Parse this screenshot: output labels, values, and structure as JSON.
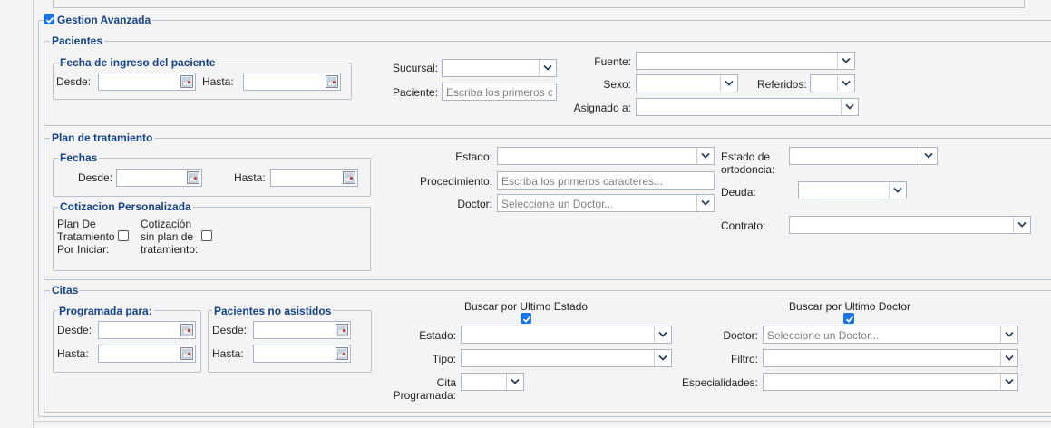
{
  "advanced": {
    "label": "Gestion Avanzada",
    "checked": true
  },
  "pacientes": {
    "legend": "Pacientes",
    "fecha_ingreso": {
      "legend": "Fecha de ingreso del paciente",
      "desde": "Desde:",
      "hasta": "Hasta:"
    },
    "sucursal": "Sucursal:",
    "paciente": {
      "label": "Paciente:",
      "placeholder": "Escriba los primeros ca"
    },
    "fuente": "Fuente:",
    "sexo": "Sexo:",
    "referidos": "Referidos:",
    "asignado": "Asignado a:"
  },
  "plan": {
    "legend": "Plan de tratamiento",
    "fechas": {
      "legend": "Fechas",
      "desde": "Desde:",
      "hasta": "Hasta:"
    },
    "cotizacion": {
      "legend": "Cotizacion Personalizada",
      "plan_iniciar": [
        "Plan De",
        "Tratamiento",
        "Por Iniciar:"
      ],
      "sin_plan": [
        "Cotización",
        "sin plan de",
        "tratamiento:"
      ]
    },
    "estado": "Estado:",
    "procedimiento": {
      "label": "Procedimiento:",
      "placeholder": "Escriba los primeros caracteres..."
    },
    "doctor": {
      "label": "Doctor:",
      "placeholder": "Seleccione un Doctor..."
    },
    "estado_ortodoncia": [
      "Estado de",
      "ortodoncia:"
    ],
    "deuda": "Deuda:",
    "contrato": "Contrato:"
  },
  "citas": {
    "legend": "Citas",
    "programada": {
      "legend": "Programada para:",
      "desde": "Desde:",
      "hasta": "Hasta:"
    },
    "no_asistidos": {
      "legend": "Pacientes no asistidos",
      "desde": "Desde:",
      "hasta": "Hasta:"
    },
    "ultimo_estado": {
      "label": "Buscar por Ultimo Estado",
      "checked": true
    },
    "ultimo_doctor": {
      "label": "Buscar por Ultimo Doctor",
      "checked": true
    },
    "estado": "Estado:",
    "tipo": "Tipo:",
    "cita_programada": [
      "Cita",
      "Programada:"
    ],
    "doctor": {
      "label": "Doctor:",
      "placeholder": "Seleccione un Doctor..."
    },
    "filtro": "Filtro:",
    "especialidades": "Especialidades:"
  },
  "colors": {
    "accent": "#15428b",
    "checkbox": "#1a73e8",
    "border": "#a9b5c4"
  }
}
